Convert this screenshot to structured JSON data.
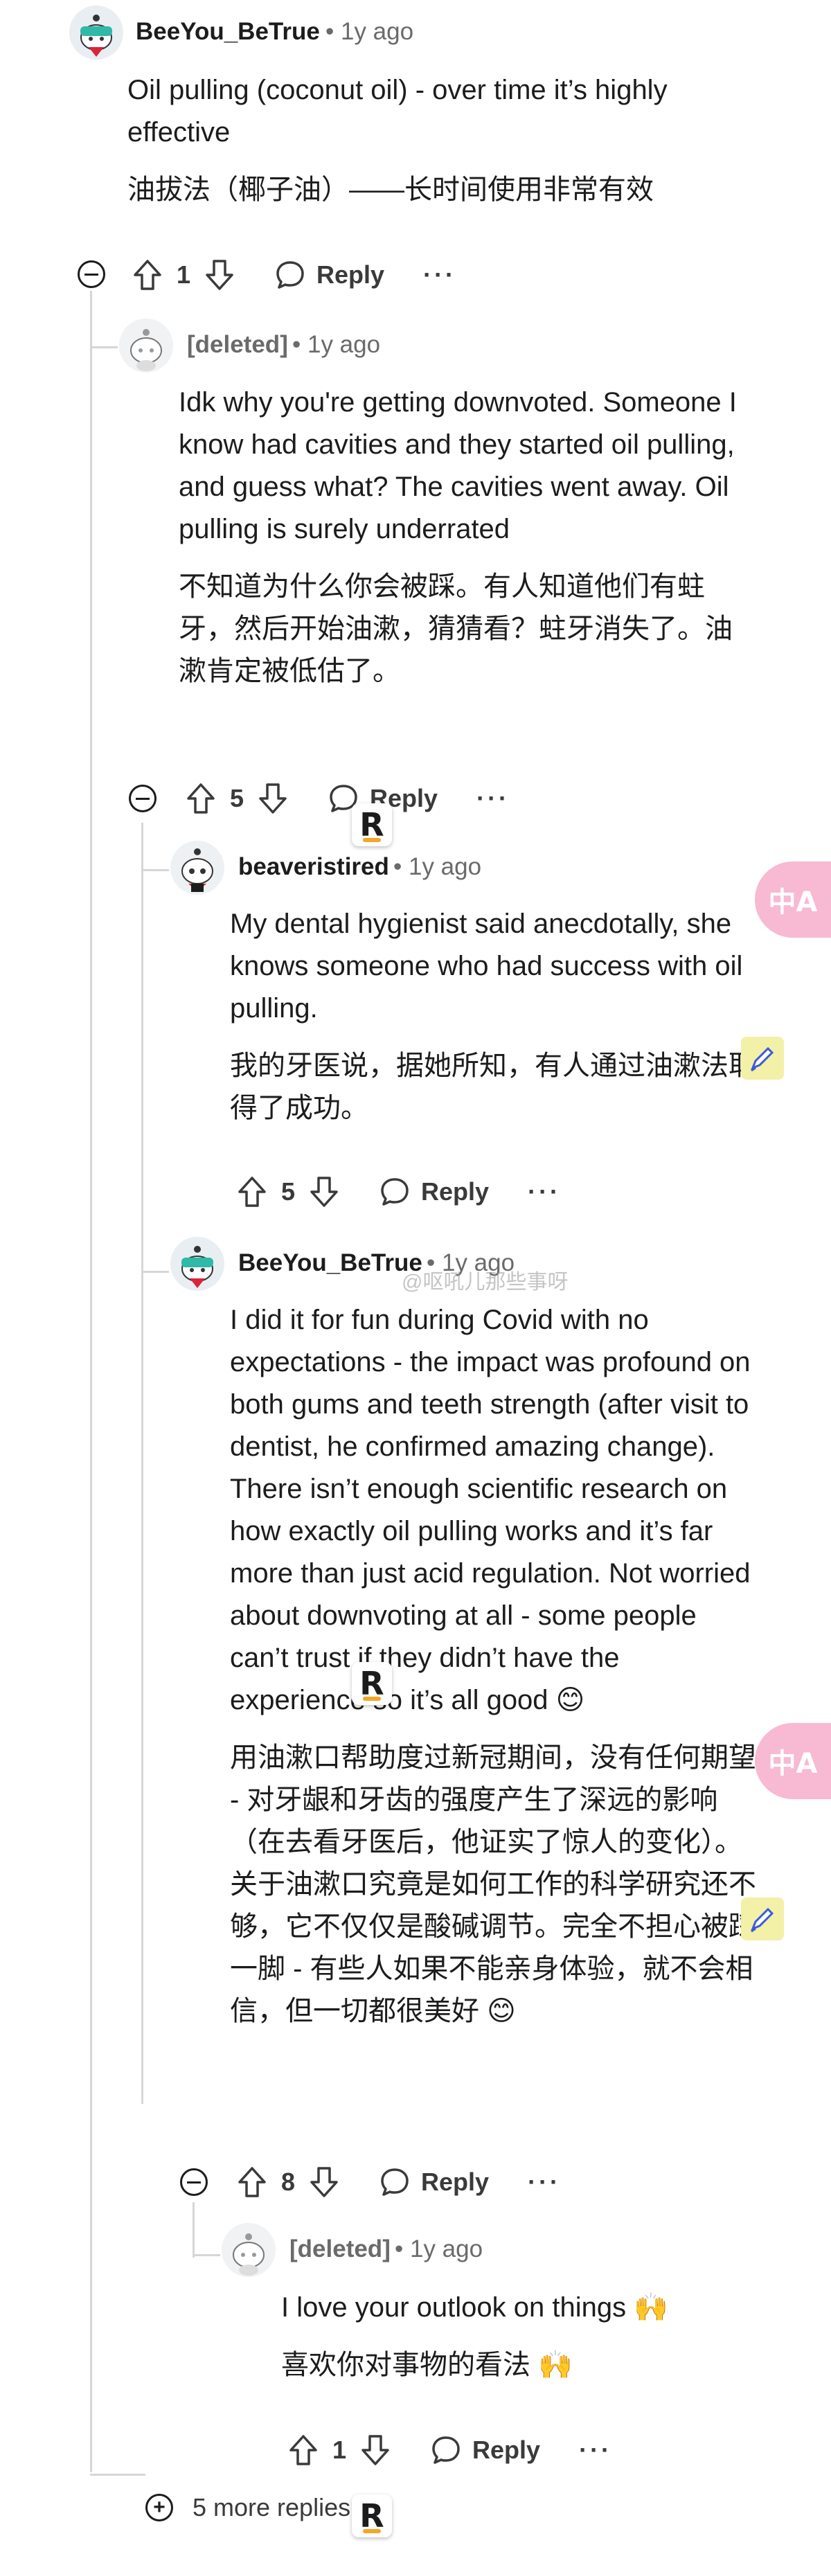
{
  "comments": [
    {
      "id": "c1",
      "username": "BeeYou_BeTrue",
      "meta": "• 1y ago",
      "paragraphs": [
        "Oil pulling (coconut oil) - over time it’s highly effective",
        "油拔法（椰子油）——长时间使用非常有效"
      ],
      "score": "1",
      "reply_label": "Reply",
      "more_label": "···"
    },
    {
      "id": "c2",
      "username": "[deleted]",
      "meta": "• 1y ago",
      "paragraphs": [
        "Idk why you're getting downvoted. Someone I know had cavities and they started oil pulling, and guess what? The cavities went away. Oil pulling is surely underrated",
        "不知道为什么你会被踩。有人知道他们有蛀牙，然后开始油漱，猜猜看？蛀牙消失了。油漱肯定被低估了。"
      ],
      "score": "5",
      "reply_label": "Reply",
      "more_label": "···"
    },
    {
      "id": "c3",
      "username": "beaveristired",
      "meta": "• 1y ago",
      "paragraphs": [
        "My dental hygienist said anecdotally, she knows someone who had success with oil pulling.",
        "我的牙医说，据她所知，有人通过油漱法取得了成功。"
      ],
      "score": "5",
      "reply_label": "Reply",
      "more_label": "···"
    },
    {
      "id": "c4",
      "username": "BeeYou_BeTrue",
      "meta": "• 1y ago",
      "paragraphs": [
        "I did it for fun during Covid with no expectations - the impact was profound on both gums and teeth strength (after visit to dentist, he confirmed amazing change). There isn’t enough scientific research on how exactly oil pulling works and it’s far more than just acid regulation. Not worried about downvoting at all - some people can’t trust if they didn’t have the experience so it’s all good 😊",
        "用油漱口帮助度过新冠期间，没有任何期望 - 对牙龈和牙齿的强度产生了深远的影响（在去看牙医后，他证实了惊人的变化）。关于油漱口究竟是如何工作的科学研究还不够，它不仅仅是酸碱调节。完全不担心被踩一脚 - 有些人如果不能亲身体验，就不会相信，但一切都很美好 😊"
      ],
      "score": "8",
      "reply_label": "Reply",
      "more_label": "···"
    },
    {
      "id": "c5",
      "username": "[deleted]",
      "meta": "• 1y ago",
      "paragraphs": [
        "I love your outlook on things 🙌",
        "喜欢你对事物的看法 🙌"
      ],
      "score": "1",
      "reply_label": "Reply",
      "more_label": "···"
    }
  ],
  "more_replies_label": "5 more replies",
  "watermark_text": "@呕吼儿那些事呀",
  "badge_letter": "R",
  "translate_fab_label": "中A",
  "colors": {
    "text": "#1c1c1c",
    "meta": "#6a6a6a",
    "thread": "#d6d6d6",
    "translate_fab": "#f8b9d2"
  },
  "icons": [
    "upvote-icon",
    "downvote-icon",
    "comment-bubble-icon",
    "collapse-minus-icon",
    "expand-plus-icon",
    "avatar-snoo-icon",
    "translate-icon",
    "pen-icon"
  ]
}
